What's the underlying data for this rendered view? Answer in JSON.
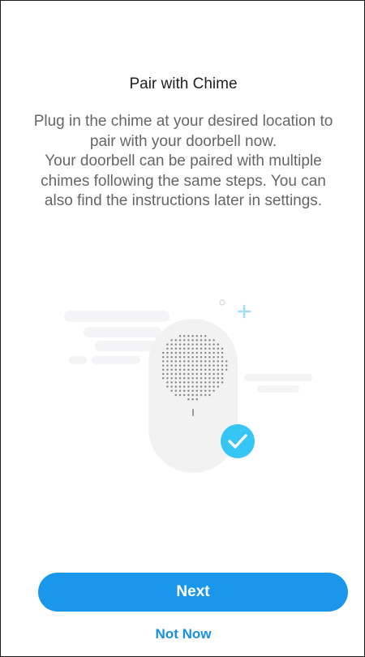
{
  "page": {
    "title": "Pair with Chime",
    "description": "Plug in the chime at your desired location to pair with your doorbell now.\nYour doorbell can be paired with multiple chimes following the same steps. You can also find the instructions later in settings."
  },
  "illustration": {
    "icons": [
      "chime-device-icon",
      "checkmark-badge-icon",
      "plus-sparkle-icon",
      "circle-sparkle-icon",
      "cloud-shape-icon"
    ],
    "colors": {
      "device_body": "#f2f2f2",
      "speaker_dots": "#8c8c8c",
      "check_badge": "#36c6f4",
      "plus_sparkle": "#9fdffb",
      "cloud": "#f4f4f6"
    }
  },
  "actions": {
    "next_label": "Next",
    "not_now_label": "Not Now"
  },
  "colors": {
    "primary_button": "#1a97ea",
    "link": "#1a8fe0",
    "title_text": "#1f1f1f",
    "body_text": "#666666"
  }
}
